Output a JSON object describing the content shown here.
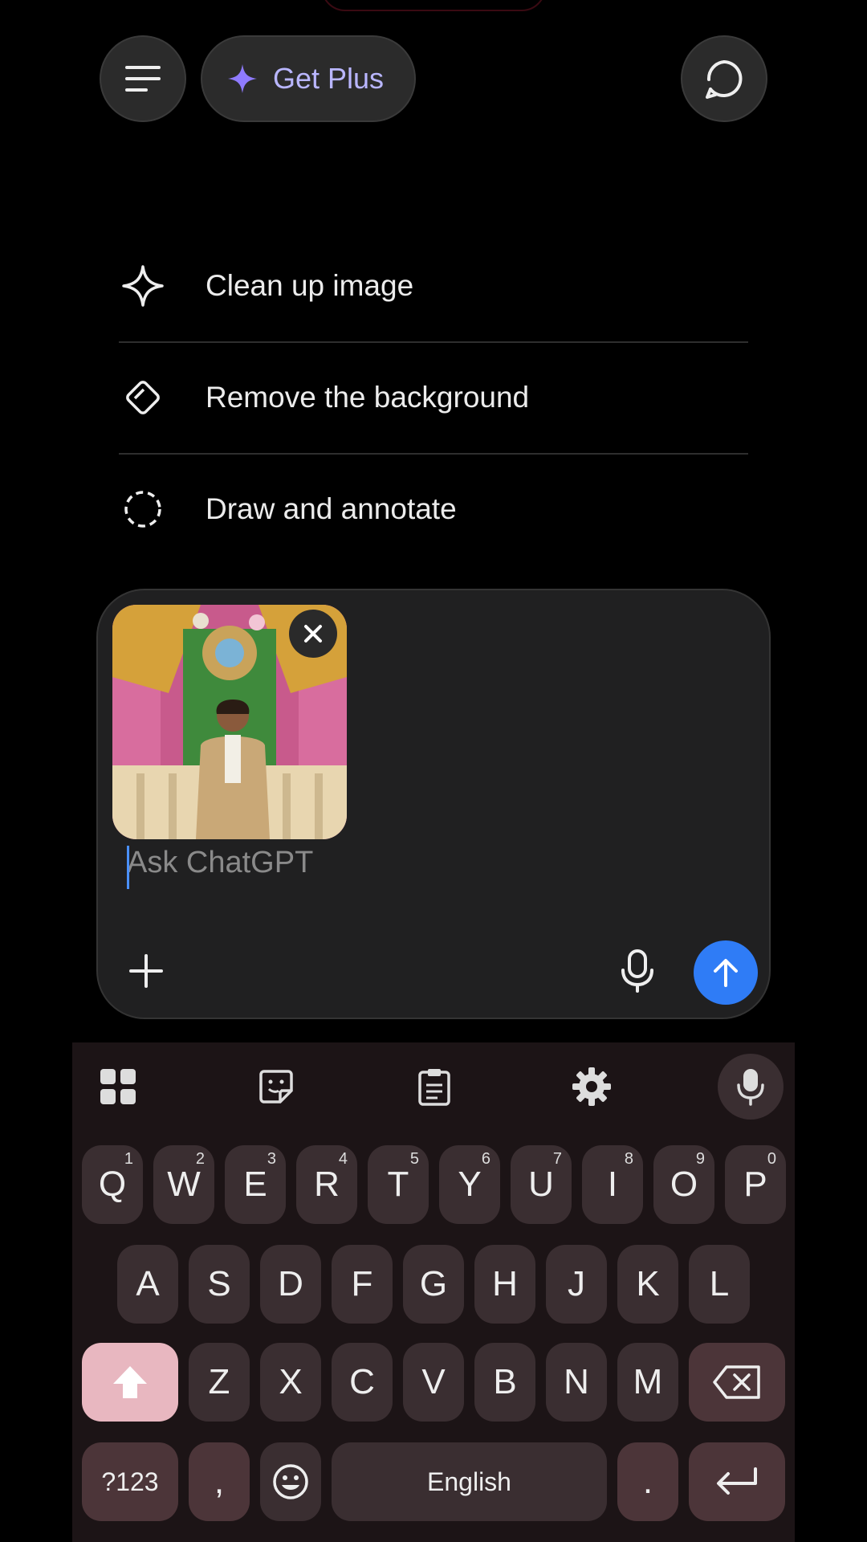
{
  "header": {
    "get_plus_label": "Get Plus",
    "menu_icon": "menu-icon",
    "sparkle_icon": "sparkle-icon",
    "new_chat_icon": "new-chat-icon"
  },
  "suggestions": [
    {
      "label": "Clean up image",
      "icon": "sparkle-outline-icon"
    },
    {
      "label": "Remove the background",
      "icon": "eraser-icon"
    },
    {
      "label": "Draw and annotate",
      "icon": "dashed-circle-icon"
    }
  ],
  "composer": {
    "placeholder": "Ask ChatGPT",
    "attachment_alt": "attached photo"
  },
  "keyboard": {
    "row1": [
      {
        "k": "Q",
        "h": "1"
      },
      {
        "k": "W",
        "h": "2"
      },
      {
        "k": "E",
        "h": "3"
      },
      {
        "k": "R",
        "h": "4"
      },
      {
        "k": "T",
        "h": "5"
      },
      {
        "k": "Y",
        "h": "6"
      },
      {
        "k": "U",
        "h": "7"
      },
      {
        "k": "I",
        "h": "8"
      },
      {
        "k": "O",
        "h": "9"
      },
      {
        "k": "P",
        "h": "0"
      }
    ],
    "row2": [
      "A",
      "S",
      "D",
      "F",
      "G",
      "H",
      "J",
      "K",
      "L"
    ],
    "row3": [
      "Z",
      "X",
      "C",
      "V",
      "B",
      "N",
      "M"
    ],
    "symbols_label": "?123",
    "comma_label": ",",
    "period_label": ".",
    "space_label": "English"
  },
  "colors": {
    "accent_blue": "#2f7cf6",
    "get_plus_text": "#b9b6ff",
    "shift_key": "#e8b7c0"
  }
}
